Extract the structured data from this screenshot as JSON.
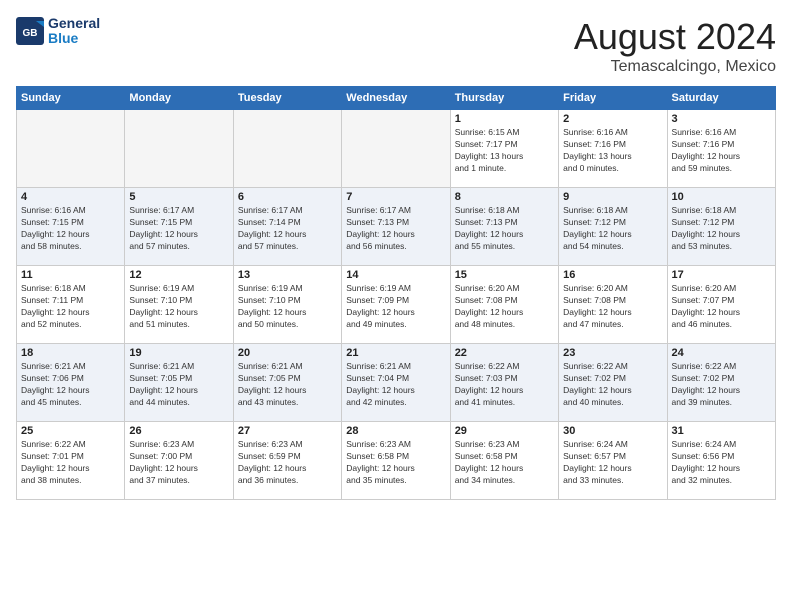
{
  "header": {
    "logo_line1": "General",
    "logo_line2": "Blue",
    "month_title": "August 2024",
    "location": "Temascalcingo, Mexico"
  },
  "weekdays": [
    "Sunday",
    "Monday",
    "Tuesday",
    "Wednesday",
    "Thursday",
    "Friday",
    "Saturday"
  ],
  "weeks": [
    [
      {
        "day": "",
        "info": ""
      },
      {
        "day": "",
        "info": ""
      },
      {
        "day": "",
        "info": ""
      },
      {
        "day": "",
        "info": ""
      },
      {
        "day": "1",
        "info": "Sunrise: 6:15 AM\nSunset: 7:17 PM\nDaylight: 13 hours\nand 1 minute."
      },
      {
        "day": "2",
        "info": "Sunrise: 6:16 AM\nSunset: 7:16 PM\nDaylight: 13 hours\nand 0 minutes."
      },
      {
        "day": "3",
        "info": "Sunrise: 6:16 AM\nSunset: 7:16 PM\nDaylight: 12 hours\nand 59 minutes."
      }
    ],
    [
      {
        "day": "4",
        "info": "Sunrise: 6:16 AM\nSunset: 7:15 PM\nDaylight: 12 hours\nand 58 minutes."
      },
      {
        "day": "5",
        "info": "Sunrise: 6:17 AM\nSunset: 7:15 PM\nDaylight: 12 hours\nand 57 minutes."
      },
      {
        "day": "6",
        "info": "Sunrise: 6:17 AM\nSunset: 7:14 PM\nDaylight: 12 hours\nand 57 minutes."
      },
      {
        "day": "7",
        "info": "Sunrise: 6:17 AM\nSunset: 7:13 PM\nDaylight: 12 hours\nand 56 minutes."
      },
      {
        "day": "8",
        "info": "Sunrise: 6:18 AM\nSunset: 7:13 PM\nDaylight: 12 hours\nand 55 minutes."
      },
      {
        "day": "9",
        "info": "Sunrise: 6:18 AM\nSunset: 7:12 PM\nDaylight: 12 hours\nand 54 minutes."
      },
      {
        "day": "10",
        "info": "Sunrise: 6:18 AM\nSunset: 7:12 PM\nDaylight: 12 hours\nand 53 minutes."
      }
    ],
    [
      {
        "day": "11",
        "info": "Sunrise: 6:18 AM\nSunset: 7:11 PM\nDaylight: 12 hours\nand 52 minutes."
      },
      {
        "day": "12",
        "info": "Sunrise: 6:19 AM\nSunset: 7:10 PM\nDaylight: 12 hours\nand 51 minutes."
      },
      {
        "day": "13",
        "info": "Sunrise: 6:19 AM\nSunset: 7:10 PM\nDaylight: 12 hours\nand 50 minutes."
      },
      {
        "day": "14",
        "info": "Sunrise: 6:19 AM\nSunset: 7:09 PM\nDaylight: 12 hours\nand 49 minutes."
      },
      {
        "day": "15",
        "info": "Sunrise: 6:20 AM\nSunset: 7:08 PM\nDaylight: 12 hours\nand 48 minutes."
      },
      {
        "day": "16",
        "info": "Sunrise: 6:20 AM\nSunset: 7:08 PM\nDaylight: 12 hours\nand 47 minutes."
      },
      {
        "day": "17",
        "info": "Sunrise: 6:20 AM\nSunset: 7:07 PM\nDaylight: 12 hours\nand 46 minutes."
      }
    ],
    [
      {
        "day": "18",
        "info": "Sunrise: 6:21 AM\nSunset: 7:06 PM\nDaylight: 12 hours\nand 45 minutes."
      },
      {
        "day": "19",
        "info": "Sunrise: 6:21 AM\nSunset: 7:05 PM\nDaylight: 12 hours\nand 44 minutes."
      },
      {
        "day": "20",
        "info": "Sunrise: 6:21 AM\nSunset: 7:05 PM\nDaylight: 12 hours\nand 43 minutes."
      },
      {
        "day": "21",
        "info": "Sunrise: 6:21 AM\nSunset: 7:04 PM\nDaylight: 12 hours\nand 42 minutes."
      },
      {
        "day": "22",
        "info": "Sunrise: 6:22 AM\nSunset: 7:03 PM\nDaylight: 12 hours\nand 41 minutes."
      },
      {
        "day": "23",
        "info": "Sunrise: 6:22 AM\nSunset: 7:02 PM\nDaylight: 12 hours\nand 40 minutes."
      },
      {
        "day": "24",
        "info": "Sunrise: 6:22 AM\nSunset: 7:02 PM\nDaylight: 12 hours\nand 39 minutes."
      }
    ],
    [
      {
        "day": "25",
        "info": "Sunrise: 6:22 AM\nSunset: 7:01 PM\nDaylight: 12 hours\nand 38 minutes."
      },
      {
        "day": "26",
        "info": "Sunrise: 6:23 AM\nSunset: 7:00 PM\nDaylight: 12 hours\nand 37 minutes."
      },
      {
        "day": "27",
        "info": "Sunrise: 6:23 AM\nSunset: 6:59 PM\nDaylight: 12 hours\nand 36 minutes."
      },
      {
        "day": "28",
        "info": "Sunrise: 6:23 AM\nSunset: 6:58 PM\nDaylight: 12 hours\nand 35 minutes."
      },
      {
        "day": "29",
        "info": "Sunrise: 6:23 AM\nSunset: 6:58 PM\nDaylight: 12 hours\nand 34 minutes."
      },
      {
        "day": "30",
        "info": "Sunrise: 6:24 AM\nSunset: 6:57 PM\nDaylight: 12 hours\nand 33 minutes."
      },
      {
        "day": "31",
        "info": "Sunrise: 6:24 AM\nSunset: 6:56 PM\nDaylight: 12 hours\nand 32 minutes."
      }
    ]
  ]
}
